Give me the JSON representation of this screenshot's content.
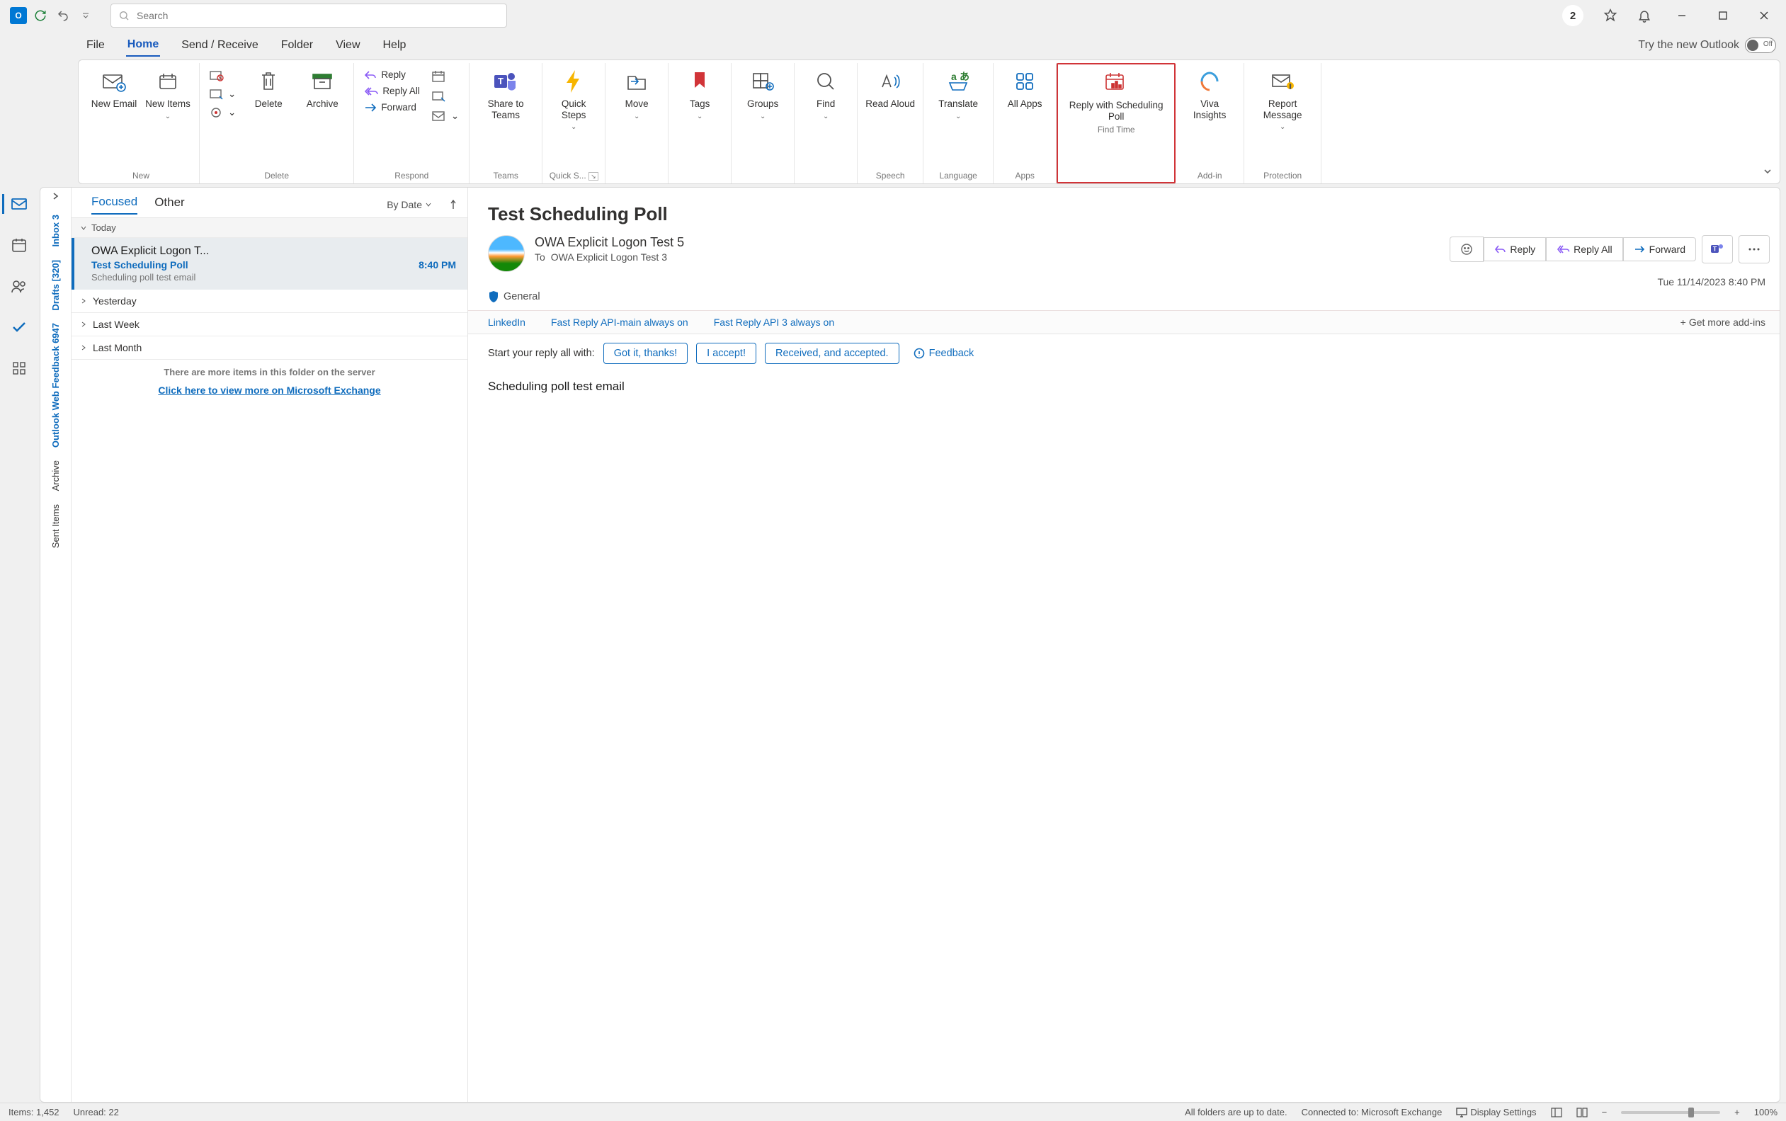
{
  "titlebar": {
    "search_placeholder": "Search",
    "notif_count": "2"
  },
  "menutabs": [
    "File",
    "Home",
    "Send / Receive",
    "Folder",
    "View",
    "Help"
  ],
  "try_new": "Try the new Outlook",
  "toggle_label": "Off",
  "ribbon": {
    "new_email": "New Email",
    "new_items": "New Items",
    "new_group": "New",
    "delete": "Delete",
    "archive": "Archive",
    "delete_group": "Delete",
    "reply": "Reply",
    "reply_all": "Reply All",
    "forward": "Forward",
    "respond_group": "Respond",
    "share_teams": "Share to Teams",
    "teams_group": "Teams",
    "quick_steps": "Quick Steps",
    "quick_group": "Quick S...",
    "move": "Move",
    "tags": "Tags",
    "groups": "Groups",
    "find": "Find",
    "read_aloud": "Read Aloud",
    "speech_group": "Speech",
    "translate": "Translate",
    "lang_group": "Language",
    "all_apps": "All Apps",
    "apps_group": "Apps",
    "reply_sched": "Reply with Scheduling Poll",
    "findtime_group": "Find Time",
    "viva": "Viva Insights",
    "addin_group": "Add-in",
    "report": "Report Message",
    "protection_group": "Protection"
  },
  "folders": {
    "inbox": "Inbox",
    "inbox_count": "3",
    "drafts": "Drafts",
    "drafts_count": "[320]",
    "owf": "Outlook Web Feedback",
    "owf_count": "6947",
    "archive": "Archive",
    "sent": "Sent Items"
  },
  "maillist": {
    "tab_focused": "Focused",
    "tab_other": "Other",
    "sort_by": "By Date",
    "hdr_today": "Today",
    "hdr_yesterday": "Yesterday",
    "hdr_lastweek": "Last Week",
    "hdr_lastmonth": "Last Month",
    "item": {
      "from": "OWA Explicit Logon T...",
      "subject": "Test Scheduling Poll",
      "time": "8:40 PM",
      "preview": "Scheduling poll test email"
    },
    "more_text": "There are more items in this folder on the server",
    "more_link": "Click here to view more on Microsoft Exchange"
  },
  "reading": {
    "title": "Test Scheduling Poll",
    "sender": "OWA Explicit Logon Test 5",
    "to_label": "To",
    "to_value": "OWA Explicit Logon Test 3",
    "date": "Tue 11/14/2023 8:40 PM",
    "reply": "Reply",
    "reply_all": "Reply All",
    "forward": "Forward",
    "security": "General",
    "addins": [
      "LinkedIn",
      "Fast Reply API-main always on",
      "Fast Reply API 3 always on"
    ],
    "get_addins": "Get more add-ins",
    "quick_label": "Start your reply all with:",
    "chips": [
      "Got it, thanks!",
      "I accept!",
      "Received, and accepted."
    ],
    "feedback": "Feedback",
    "body": "Scheduling poll test email"
  },
  "status": {
    "items": "Items: 1,452",
    "unread": "Unread: 22",
    "uptodate": "All folders are up to date.",
    "connected": "Connected to: Microsoft Exchange",
    "display": "Display Settings",
    "zoom": "100%"
  }
}
